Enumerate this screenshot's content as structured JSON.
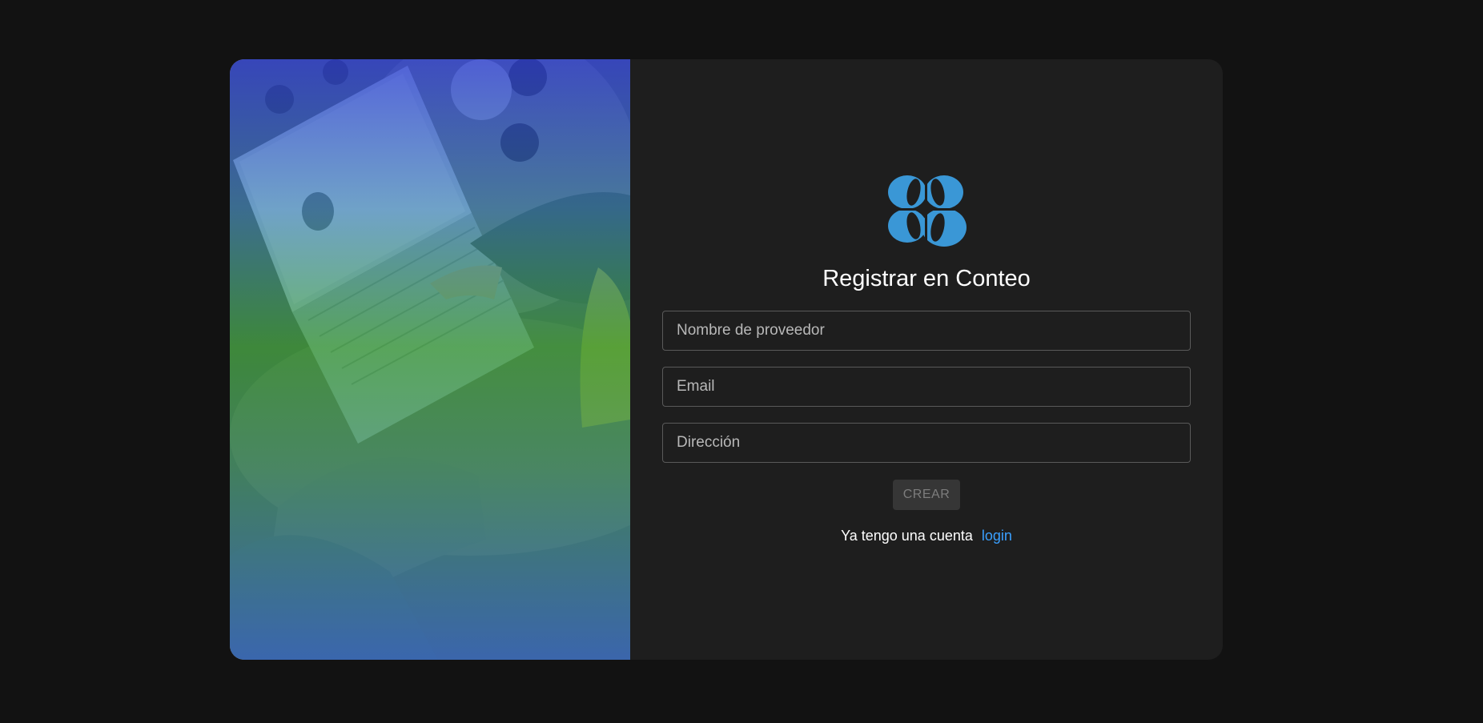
{
  "register": {
    "title": "Registrar en Conteo",
    "fields": [
      {
        "placeholder": "Nombre de proveedor",
        "value": ""
      },
      {
        "placeholder": "Email",
        "value": ""
      },
      {
        "placeholder": "Dirección",
        "value": ""
      }
    ],
    "submit_label": "CREAR",
    "submit_disabled": true,
    "footer_text": "Ya tengo una cuenta",
    "login_link": "login"
  },
  "colors": {
    "page_background": "#121212",
    "card_background": "#1e1e1e",
    "logo_blue": "#3a97d6",
    "link_blue": "#3aa0ff",
    "button_disabled": "#363636"
  },
  "icons": {
    "logo": "clover-logo-icon"
  }
}
